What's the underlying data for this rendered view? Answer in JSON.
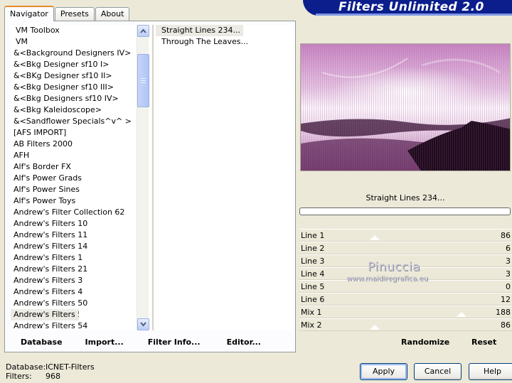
{
  "window": {
    "title": "Filters Unlimited 2.0"
  },
  "tabs": [
    {
      "label": "Navigator",
      "active": true
    },
    {
      "label": "Presets",
      "active": false
    },
    {
      "label": "About",
      "active": false
    }
  ],
  "categories": [
    "VM Toolbox",
    "VM",
    "&<Background Designers IV>",
    "&<Bkg Designer sf10 I>",
    "&<BKg Designer sf10 II>",
    "&<Bkg Designer sf10 III>",
    "&<Bkg Designers sf10 IV>",
    "&<Bkg Kaleidoscope>",
    "&<Sandflower Specials^v^ >",
    "[AFS IMPORT]",
    "AB Filters 2000",
    "AFH",
    "Alf's Border FX",
    "Alf's Power Grads",
    "Alf's Power Sines",
    "Alf's Power Toys",
    "Andrew's Filter Collection 62",
    "Andrew's Filters 10",
    "Andrew's Filters 11",
    "Andrew's Filters 14",
    "Andrew's Filters 1",
    "Andrew's Filters 21",
    "Andrew's Filters 3",
    "Andrew's Filters 4",
    "Andrew's Filters 50",
    "Andrew's Filters 51",
    "Andrew's Filters 54"
  ],
  "selected_category": "Andrew's Filters 51",
  "filters": [
    "Straight Lines 234...",
    "Through The Leaves..."
  ],
  "selected_filter": "Straight Lines 234...",
  "bottom_buttons": {
    "database": "Database",
    "import": "Import...",
    "filter_info": "Filter Info...",
    "editor": "Editor..."
  },
  "preview": {
    "filter_name": "Straight Lines 234...",
    "progress": 0
  },
  "params": [
    {
      "name": "Line 1",
      "value": "86",
      "slider": 86
    },
    {
      "name": "Line 2",
      "value": "6",
      "slider": 6
    },
    {
      "name": "Line 3",
      "value": "3",
      "slider": 3
    },
    {
      "name": "Line 4",
      "value": "3",
      "slider": 3
    },
    {
      "name": "Line 5",
      "value": "0",
      "slider": 0
    },
    {
      "name": "Line 6",
      "value": "12",
      "slider": 12
    },
    {
      "name": "Mix 1",
      "value": "188",
      "slider": 188
    },
    {
      "name": "Mix 2",
      "value": "86",
      "slider": 86
    }
  ],
  "watermark": {
    "name": "Pinuccia",
    "url": "www.maidiregrafica.eu"
  },
  "actions": {
    "randomize": "Randomize",
    "reset": "Reset"
  },
  "status": {
    "database_label": "Database:",
    "database_value": "ICNET-Filters",
    "filters_label": "Filters:",
    "filters_value": "968"
  },
  "dialog_buttons": {
    "apply": "Apply",
    "cancel": "Cancel",
    "help": "Help"
  },
  "colors": {
    "accent": "#0b1e8c",
    "tab_highlight": "#e68b2c",
    "preview_tint": "#c98bc4"
  }
}
